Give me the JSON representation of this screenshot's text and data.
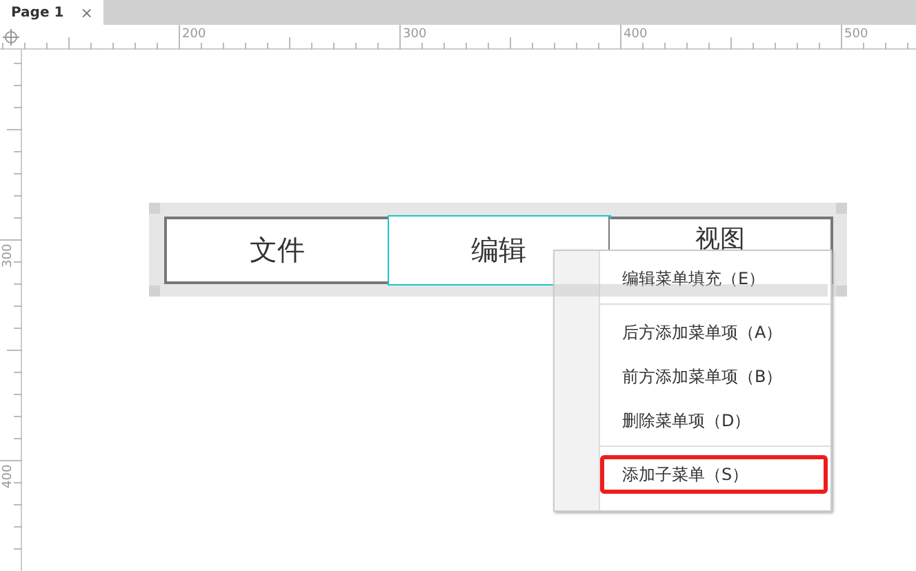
{
  "tabs": [
    {
      "label": "Page 1",
      "selected": true,
      "close": "×"
    }
  ],
  "ruler": {
    "horizontal_labels": [
      "200",
      "300",
      "400",
      "500"
    ],
    "vertical_labels": [
      "300",
      "400"
    ]
  },
  "menu_bar": {
    "items": [
      {
        "label": "文件",
        "selected": false
      },
      {
        "label": "编辑",
        "selected": true
      },
      {
        "label": "视图",
        "selected": false
      }
    ]
  },
  "context_menu": {
    "items": [
      {
        "kind": "item",
        "label": "编辑菜单填充（E）",
        "highlighted": false
      },
      {
        "kind": "separator"
      },
      {
        "kind": "item",
        "label": "后方添加菜单项（A）",
        "highlighted": false
      },
      {
        "kind": "item",
        "label": "前方添加菜单项（B）",
        "highlighted": false
      },
      {
        "kind": "item",
        "label": "删除菜单项（D）",
        "highlighted": false
      },
      {
        "kind": "separator"
      },
      {
        "kind": "item",
        "label": "添加子菜单（S）",
        "highlighted": true
      }
    ]
  }
}
